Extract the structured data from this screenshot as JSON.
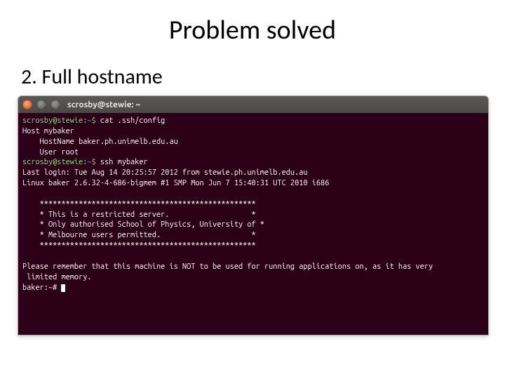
{
  "slide": {
    "title": "Problem solved",
    "subtitle": "2. Full hostname"
  },
  "window": {
    "title": "scrosby@stewie: ~"
  },
  "term": {
    "p1_user": "scrosby@stewie",
    "p1_path": "~",
    "p1_cmd": "cat .ssh/config",
    "cfg_l1": "Host mybaker",
    "cfg_l2": "    HostName baker.ph.unimelb.edu.au",
    "cfg_l3": "    User root",
    "p2_user": "scrosby@stewie",
    "p2_path": "~",
    "p2_cmd": "ssh mybaker",
    "login_l1": "Last login: Tue Aug 14 20:25:57 2012 from stewie.ph.unimelb.edu.au",
    "login_l2": "Linux baker 2.6.32-4-686-bigmem #1 SMP Mon Jun 7 15:40:31 UTC 2010 i686",
    "banner_l1": "    **************************************************",
    "banner_l2": "    * This is a restricted server.                   *",
    "banner_l3": "    * Only authorised School of Physics, University of *",
    "banner_l4": "    * Melbourne users permitted.                     *",
    "banner_l5": "    **************************************************",
    "notice_l1": "Please remember that this machine is NOT to be used for running applications on, as it has very",
    "notice_l2": " limited memory.",
    "p3_prompt": "baker:~#"
  }
}
